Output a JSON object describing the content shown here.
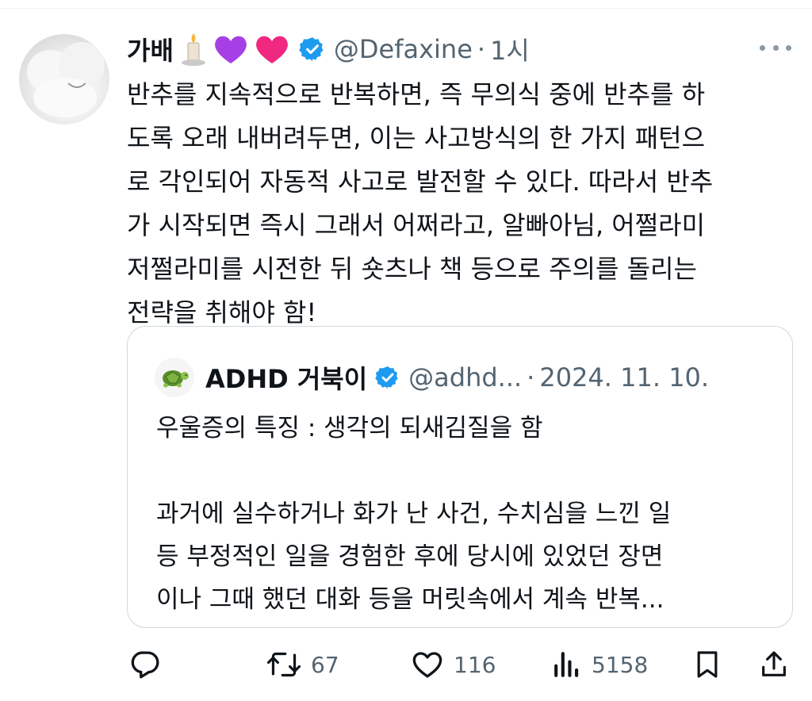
{
  "tweet": {
    "author_name": "가배",
    "name_emojis": [
      "🕯️",
      "💜",
      "💗"
    ],
    "handle": "@Defaxine",
    "separator": "·",
    "time": "1시",
    "body_lines": [
      "반추를 지속적으로 반복하면, 즉 무의식 중에 반추를 하",
      "도록 오래 내버려두면, 이는 사고방식의 한 가지 패턴으",
      "로 각인되어 자동적 사고로 발전할 수 있다. 따라서 반추",
      "가 시작되면 즉시 그래서 어쩌라고, 알빠아님, 어쩔라미",
      "저쩔라미를 시전한 뒤 숏츠나 책 등으로 주의를 돌리는",
      "전략을 취해야 함!"
    ],
    "verified_icon": "verified-badge-icon",
    "more_icon": "more-options-icon"
  },
  "quote": {
    "avatar_emoji": "🐢",
    "author_name": "ADHD 거북이",
    "handle": "@adhd...",
    "separator": "·",
    "date": "2024. 11. 10.",
    "lines": [
      "우울증의 특징 : 생각의 되새김질을 함",
      "",
      "과거에 실수하거나 화가 난 사건, 수치심을 느낀 일",
      "등 부정적인 일을 경험한 후에 당시에 있었던 장면",
      "이나 그때 했던 대화 등을 머릿속에서 계속 반복..."
    ]
  },
  "actions": {
    "reply_icon": "reply-icon",
    "repost_icon": "repost-icon",
    "repost_count": "67",
    "like_icon": "heart-icon",
    "like_count": "116",
    "views_icon": "views-icon",
    "views_count": "5158",
    "bookmark_icon": "bookmark-icon",
    "share_icon": "share-icon"
  },
  "colors": {
    "text": "#0f1419",
    "secondary": "#536471",
    "verified": "#1d9bf0",
    "border": "#cfd9de"
  }
}
